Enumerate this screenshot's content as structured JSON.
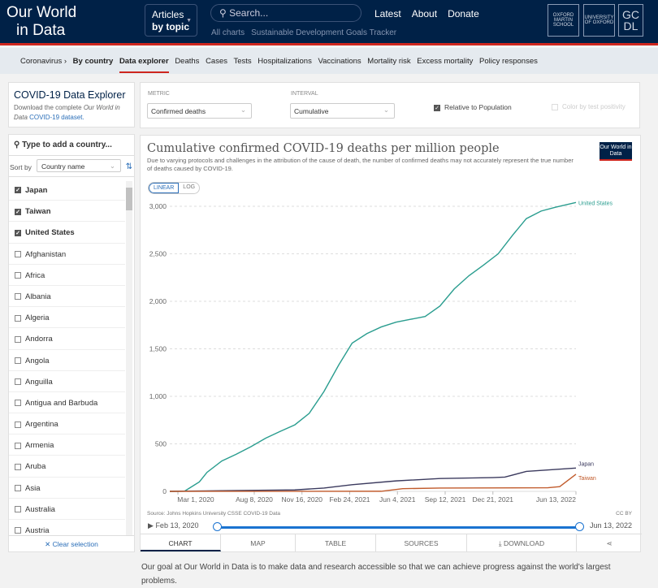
{
  "header": {
    "logo_line1": "Our World",
    "logo_line2": "in Data",
    "articles": "Articles",
    "by_topic": "by topic",
    "search_placeholder": "Search...",
    "links": [
      "Latest",
      "About",
      "Donate"
    ],
    "sublinks": [
      "All charts",
      "Sustainable Development Goals Tracker"
    ],
    "badges": [
      "OXFORD MARTIN SCHOOL",
      "UNIVERSITY OF OXFORD",
      "GC DL"
    ]
  },
  "nav": {
    "items": [
      "Coronavirus ›",
      "By country",
      "Data explorer",
      "Deaths",
      "Cases",
      "Tests",
      "Hospitalizations",
      "Vaccinations",
      "Mortality risk",
      "Excess mortality",
      "Policy responses"
    ],
    "active": "Data explorer"
  },
  "sidebar": {
    "title": "COVID-19 Data Explorer",
    "desc_prefix": "Download the complete ",
    "desc_em": "Our World in Data",
    "desc_link": " COVID-19 dataset.",
    "search_placeholder": "Type to add a country...",
    "sort_label": "Sort by",
    "sort_value": "Country name",
    "countries": [
      {
        "name": "Japan",
        "checked": true
      },
      {
        "name": "Taiwan",
        "checked": true
      },
      {
        "name": "United States",
        "checked": true
      },
      {
        "name": "Afghanistan",
        "checked": false
      },
      {
        "name": "Africa",
        "checked": false
      },
      {
        "name": "Albania",
        "checked": false
      },
      {
        "name": "Algeria",
        "checked": false
      },
      {
        "name": "Andorra",
        "checked": false
      },
      {
        "name": "Angola",
        "checked": false
      },
      {
        "name": "Anguilla",
        "checked": false
      },
      {
        "name": "Antigua and Barbuda",
        "checked": false
      },
      {
        "name": "Argentina",
        "checked": false
      },
      {
        "name": "Armenia",
        "checked": false
      },
      {
        "name": "Aruba",
        "checked": false
      },
      {
        "name": "Asia",
        "checked": false
      },
      {
        "name": "Australia",
        "checked": false
      },
      {
        "name": "Austria",
        "checked": false
      }
    ],
    "clear": "✕ Clear selection"
  },
  "controls": {
    "metric_label": "METRIC",
    "metric_value": "Confirmed deaths",
    "interval_label": "INTERVAL",
    "interval_value": "Cumulative",
    "relative": "Relative to Population",
    "relative_checked": true,
    "color_positivity": "Color by test positivity",
    "color_positivity_checked": false
  },
  "chart": {
    "logo": "Our World in Data",
    "linear": "LINEAR",
    "log": "LOG",
    "source": "Source: Johns Hopkins University CSSE COVID-19 Data",
    "license": "CC BY",
    "start": "Feb 13, 2020",
    "end": "Jun 13, 2022",
    "tabs": [
      "CHART",
      "MAP",
      "TABLE",
      "SOURCES",
      "⤓ DOWNLOAD",
      "⋖"
    ]
  },
  "chart_data": {
    "type": "line",
    "title": "Cumulative confirmed COVID-19 deaths per million people",
    "subtitle": "Due to varying protocols and challenges in the attribution of the cause of death, the number of confirmed deaths may not accurately represent the true number of deaths caused by COVID-19.",
    "xlim": [
      "2020-02-13",
      "2022-06-13"
    ],
    "ylim": [
      0,
      3000
    ],
    "yticks": [
      0,
      500,
      1000,
      1500,
      2000,
      2500,
      3000
    ],
    "ytick_labels": [
      "0",
      "500",
      "1,000",
      "1,500",
      "2,000",
      "2,500",
      "3,000"
    ],
    "xticks": [
      "2020-03-01",
      "2020-08-08",
      "2020-11-16",
      "2021-02-24",
      "2021-06-04",
      "2021-09-12",
      "2021-12-21",
      "2022-06-13"
    ],
    "xtick_labels": [
      "Mar 1, 2020",
      "Aug 8, 2020",
      "Nov 16, 2020",
      "Feb 24, 2021",
      "Jun 4, 2021",
      "Sep 12, 2021",
      "Dec 21, 2021",
      "Jun 13, 2022"
    ],
    "grid": "horizontal",
    "legend": "line-end labels",
    "series": [
      {
        "name": "United States",
        "color": "#2a9d8f",
        "points": [
          [
            "2020-02-13",
            0
          ],
          [
            "2020-03-15",
            2
          ],
          [
            "2020-04-15",
            100
          ],
          [
            "2020-05-01",
            200
          ],
          [
            "2020-06-01",
            320
          ],
          [
            "2020-07-01",
            390
          ],
          [
            "2020-08-01",
            470
          ],
          [
            "2020-09-01",
            560
          ],
          [
            "2020-10-01",
            630
          ],
          [
            "2020-11-01",
            700
          ],
          [
            "2020-12-01",
            820
          ],
          [
            "2021-01-01",
            1050
          ],
          [
            "2021-02-01",
            1330
          ],
          [
            "2021-03-01",
            1560
          ],
          [
            "2021-04-01",
            1660
          ],
          [
            "2021-05-01",
            1730
          ],
          [
            "2021-06-01",
            1780
          ],
          [
            "2021-07-01",
            1810
          ],
          [
            "2021-08-01",
            1840
          ],
          [
            "2021-09-01",
            1950
          ],
          [
            "2021-10-01",
            2130
          ],
          [
            "2021-11-01",
            2270
          ],
          [
            "2021-12-01",
            2380
          ],
          [
            "2022-01-01",
            2500
          ],
          [
            "2022-02-01",
            2700
          ],
          [
            "2022-03-01",
            2870
          ],
          [
            "2022-04-01",
            2950
          ],
          [
            "2022-05-01",
            2990
          ],
          [
            "2022-06-13",
            3040
          ]
        ]
      },
      {
        "name": "Japan",
        "color": "#3b3a5e",
        "points": [
          [
            "2020-02-13",
            0
          ],
          [
            "2020-06-01",
            7
          ],
          [
            "2020-11-01",
            15
          ],
          [
            "2021-01-01",
            35
          ],
          [
            "2021-03-01",
            70
          ],
          [
            "2021-06-01",
            110
          ],
          [
            "2021-09-01",
            135
          ],
          [
            "2021-12-21",
            145
          ],
          [
            "2022-01-15",
            150
          ],
          [
            "2022-03-01",
            210
          ],
          [
            "2022-06-13",
            245
          ]
        ]
      },
      {
        "name": "Taiwan",
        "color": "#c15b2c",
        "points": [
          [
            "2020-02-13",
            0
          ],
          [
            "2021-05-01",
            1
          ],
          [
            "2021-06-15",
            28
          ],
          [
            "2021-09-01",
            35
          ],
          [
            "2022-04-15",
            38
          ],
          [
            "2022-05-10",
            50
          ],
          [
            "2022-06-13",
            180
          ]
        ]
      }
    ]
  },
  "footer": {
    "text": "Our goal at Our World in Data is to make data and research accessible so that we can achieve progress against the world's largest problems."
  }
}
